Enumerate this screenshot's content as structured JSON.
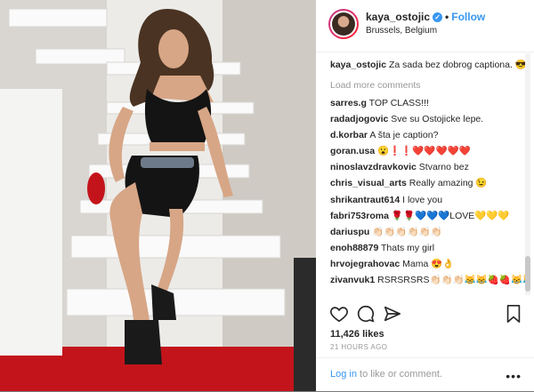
{
  "post": {
    "username": "kaya_ostojic",
    "follow_label": "Follow",
    "location": "Brussels, Belgium",
    "caption_user": "kaya_ostojic",
    "caption_text": " Za sada bez dobrog captiona. 😎",
    "load_more": "Load more comments",
    "likes": "11,426 likes",
    "time": "21 HOURS AGO",
    "login_link": "Log in",
    "login_rest": " to like or comment.",
    "more_glyph": "•••"
  },
  "comments": [
    {
      "user": "sarres.g",
      "text": " TOP CLASS!!!"
    },
    {
      "user": "radadjogovic",
      "text": " Sve su Ostojicke lepe."
    },
    {
      "user": "d.korbar",
      "text": " A šta je caption?"
    },
    {
      "user": "goran.usa",
      "text": " 😮❗❗❤️❤️❤️❤️❤️"
    },
    {
      "user": "ninoslavzdravkovic",
      "text": " Stvarno bez"
    },
    {
      "user": "chris_visual_arts",
      "text": " Really amazing 😉"
    },
    {
      "user": "shrikantraut614",
      "text": " I love you"
    },
    {
      "user": "fabri753roma",
      "text": " 🌹🌹💙💙💙LOVE💛💛💛"
    },
    {
      "user": "dariuspu",
      "text": " 👏🏻👏🏻👏🏻👏🏻👏🏻👏🏻"
    },
    {
      "user": "enoh88879",
      "text": " Thats my girl"
    },
    {
      "user": "hrvojegrahovac",
      "text": " Mama 😍👌"
    },
    {
      "user": "zivanvuk1",
      "text": " RSRSRSRS👏🏻👏🏻👏🏻😹😹🍓🍓😹😹😹🍒🍒👏🏻👏🏻😎😎😹🍓"
    }
  ],
  "icons": [
    "heart-icon",
    "comment-icon",
    "share-icon",
    "bookmark-icon",
    "verified-badge-icon"
  ]
}
